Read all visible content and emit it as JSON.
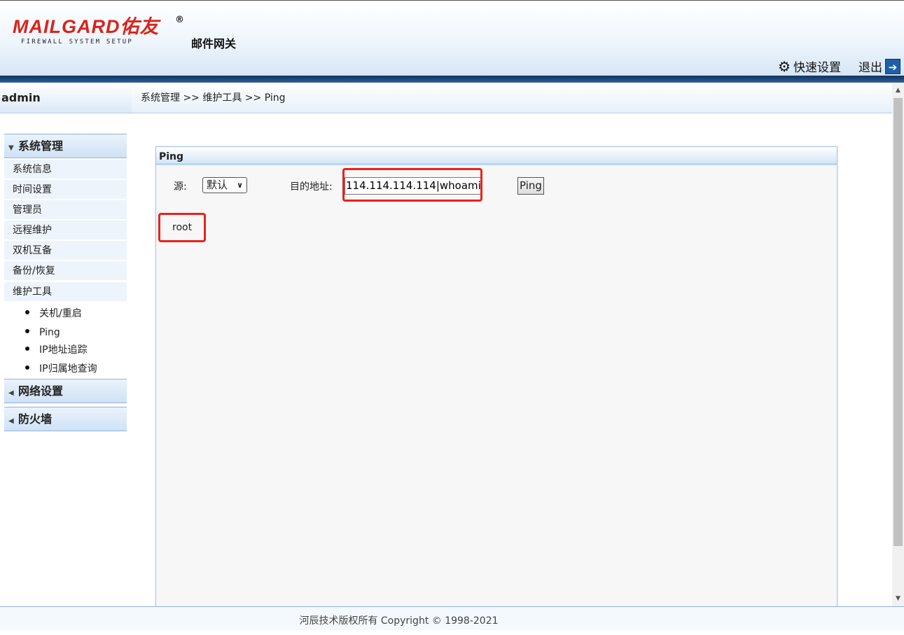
{
  "header": {
    "logo_text": "MAILGARD佑友",
    "logo_subtitle": "FIREWALL SYSTEM SETUP",
    "logo_registered": "®",
    "product_name": "邮件网关",
    "quick_setup_label": "快速设置",
    "logout_label": "退出",
    "icons": {
      "quick_setup": "gear-icon",
      "logout": "exit-icon"
    }
  },
  "user": {
    "name": "admin"
  },
  "sidebar": {
    "sections": [
      {
        "label": "系统管理",
        "expanded": true,
        "items": [
          {
            "label": "系统信息"
          },
          {
            "label": "时间设置"
          },
          {
            "label": "管理员"
          },
          {
            "label": "远程维护"
          },
          {
            "label": "双机互备"
          },
          {
            "label": "备份/恢复"
          },
          {
            "label": "维护工具"
          }
        ],
        "subitems": [
          {
            "label": "关机/重启"
          },
          {
            "label": "Ping"
          },
          {
            "label": "IP地址追踪"
          },
          {
            "label": "IP归属地查询"
          }
        ]
      },
      {
        "label": "网络设置",
        "expanded": false
      },
      {
        "label": "防火墙",
        "expanded": false
      }
    ]
  },
  "breadcrumb": "系统管理 >> 维护工具 >> Ping",
  "panel": {
    "title": "Ping",
    "source_label": "源:",
    "source_value": "默认",
    "destination_label": "目的地址:",
    "destination_value": "114.114.114.114|whoami",
    "ping_button": "Ping",
    "result": "root"
  },
  "footer": {
    "copyright": "河辰技术版权所有 Copyright © 1998-2021"
  },
  "colors": {
    "accent_red": "#e8221c",
    "header_bar": "#1f4d86",
    "logo_red": "#d9241a"
  }
}
